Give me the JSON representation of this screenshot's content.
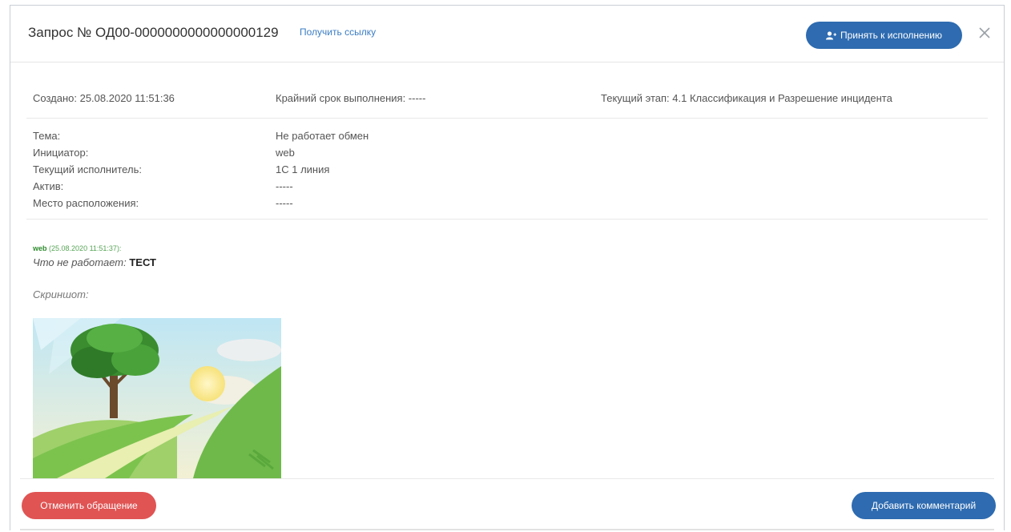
{
  "header": {
    "title": "Запрос № ОД00-0000000000000000129",
    "get_link": "Получить ссылку",
    "accept_button": "Принять к исполнению",
    "close_icon": "close-icon"
  },
  "meta": {
    "created": "Создано: 25.08.2020 11:51:36",
    "deadline": "Крайний срок выполнения: -----",
    "stage": "Текущий этап: 4.1 Классификация и Разрешение инцидента"
  },
  "details": [
    {
      "label": "Тема:",
      "value": "Не работает обмен"
    },
    {
      "label": "Инициатор:",
      "value": "web"
    },
    {
      "label": "Текущий исполнитель:",
      "value": "1С 1 линия"
    },
    {
      "label": "Актив:",
      "value": "-----"
    },
    {
      "label": "Место расположения:",
      "value": "-----"
    }
  ],
  "comment": {
    "author": "web",
    "timestamp": "(25.08.2020 11:51:37):",
    "question_label": "Что не работает:",
    "answer": "ТЕСТ",
    "screenshot_label": "Скриншот:"
  },
  "footer": {
    "cancel_button": "Отменить обращение",
    "add_comment_button": "Добавить комментарий"
  },
  "colors": {
    "primary": "#2e6bb0",
    "danger": "#e05454",
    "author": "#2e8b2e",
    "link": "#3b7dc4"
  }
}
